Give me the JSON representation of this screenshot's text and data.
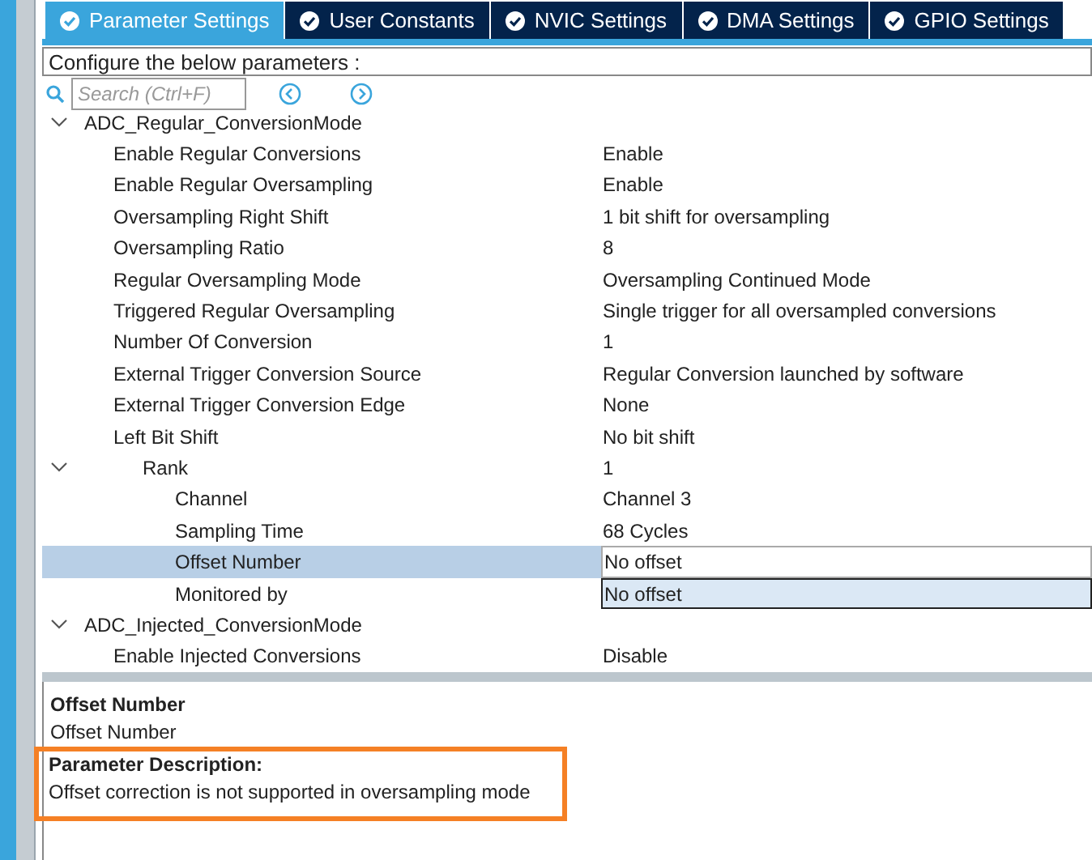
{
  "tabs": [
    {
      "label": "Parameter Settings",
      "selected": true
    },
    {
      "label": "User Constants",
      "selected": false
    },
    {
      "label": "NVIC Settings",
      "selected": false
    },
    {
      "label": "DMA Settings",
      "selected": false
    },
    {
      "label": "GPIO Settings",
      "selected": false
    }
  ],
  "configure_label": "Configure the below parameters :",
  "search": {
    "placeholder": "Search (Ctrl+F)"
  },
  "tree": [
    {
      "label": "ADC_Regular_ConversionMode",
      "expanded": true,
      "children": [
        {
          "label": "Enable Regular Conversions",
          "value": "Enable",
          "selected": false,
          "kind": "text"
        },
        {
          "label": "Enable Regular Oversampling",
          "value": "Enable",
          "selected": false,
          "kind": "text"
        },
        {
          "label": "Oversampling Right Shift",
          "value": "1 bit shift for oversampling",
          "selected": false,
          "kind": "text"
        },
        {
          "label": "Oversampling Ratio",
          "value": "8",
          "selected": false,
          "kind": "text"
        },
        {
          "label": "Regular Oversampling Mode",
          "value": "Oversampling Continued Mode",
          "selected": false,
          "kind": "text"
        },
        {
          "label": "Triggered Regular Oversampling",
          "value": "Single trigger for all oversampled conversions",
          "selected": false,
          "kind": "text"
        },
        {
          "label": "Number Of Conversion",
          "value": "1",
          "selected": false,
          "kind": "text"
        },
        {
          "label": "External Trigger Conversion Source",
          "value": "Regular Conversion launched by software",
          "selected": false,
          "kind": "text"
        },
        {
          "label": "External Trigger Conversion Edge",
          "value": "None",
          "selected": false,
          "kind": "text"
        },
        {
          "label": "Left Bit Shift",
          "value": "No bit shift",
          "selected": false,
          "kind": "text"
        },
        {
          "label": "Rank",
          "value": "1",
          "selected": false,
          "kind": "text",
          "expanded": true,
          "children": [
            {
              "label": "Channel",
              "value": "Channel 3",
              "selected": false,
              "kind": "text"
            },
            {
              "label": "Sampling Time",
              "value": "68 Cycles",
              "selected": false,
              "kind": "text"
            },
            {
              "label": "Offset Number",
              "value": "No offset",
              "selected": true,
              "kind": "field"
            },
            {
              "label": "Monitored by",
              "value": "No offset",
              "selected": false,
              "kind": "focused"
            }
          ]
        }
      ]
    },
    {
      "label": "ADC_Injected_ConversionMode",
      "expanded": true,
      "children": [
        {
          "label": "Enable Injected Conversions",
          "value": "Disable",
          "selected": false,
          "kind": "text"
        }
      ]
    }
  ],
  "description": {
    "title": "Offset Number",
    "name": "Offset Number",
    "heading": "Parameter Description:",
    "text": "Offset correction is not supported in oversampling mode"
  }
}
